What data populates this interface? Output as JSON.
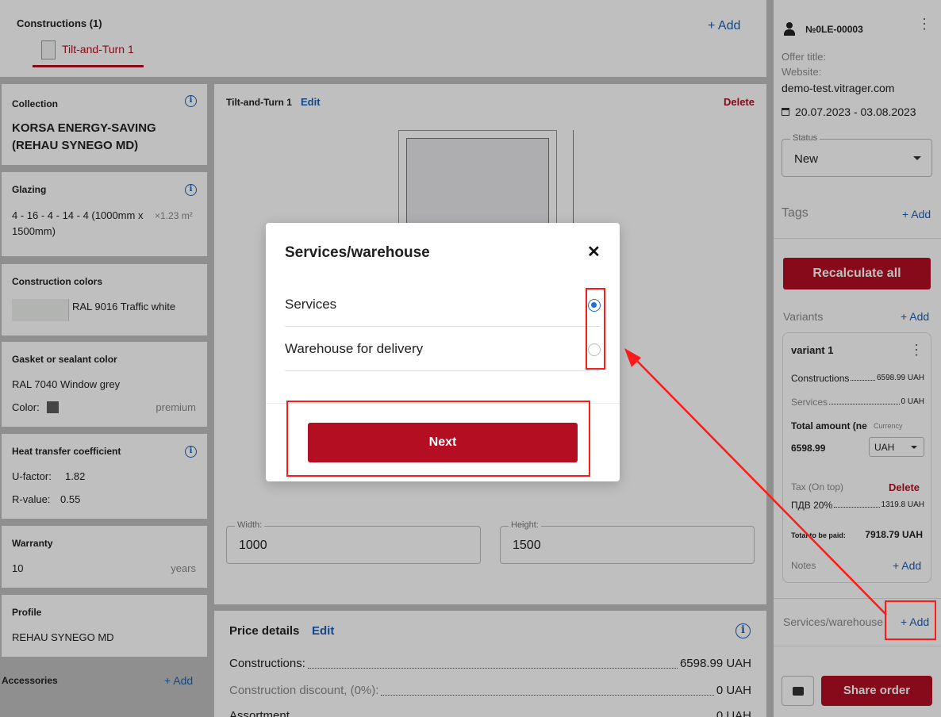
{
  "constructions": {
    "title": "Constructions (1)",
    "add": "+ Add",
    "tab": "Tilt-and-Turn 1"
  },
  "cards": {
    "collection": {
      "title": "Collection",
      "value": "KORSA ENERGY-SAVING (REHAU SYNEGO MD)"
    },
    "glazing": {
      "title": "Glazing",
      "value": "4 - 16 - 4 - 14 - 4 (1000mm x 1500mm)",
      "area": "×1.23 m²"
    },
    "colors": {
      "title": "Construction colors",
      "value": "RAL 9016 Traffic white"
    },
    "gasket": {
      "title": "Gasket or sealant color",
      "value": "RAL 7040 Window grey",
      "color_label": "Color:",
      "premium": "premium"
    },
    "heat": {
      "title": "Heat transfer coefficient",
      "u_label": "U-factor:",
      "u_value": "1.82",
      "r_label": "R-value:",
      "r_value": "0.55"
    },
    "warranty": {
      "title": "Warranty",
      "value": "10",
      "unit": "years"
    },
    "profile": {
      "title": "Profile",
      "value": "REHAU SYNEGO MD"
    },
    "accessories": {
      "title": "Accessories",
      "add": "+ Add"
    }
  },
  "center": {
    "name": "Tilt-and-Turn 1",
    "edit": "Edit",
    "delete": "Delete",
    "width_label": "Width:",
    "width_value": "1000",
    "height_label": "Height:",
    "height_value": "1500"
  },
  "price": {
    "title": "Price details",
    "edit": "Edit",
    "rows": [
      {
        "label": "Constructions:",
        "value": "6598.99 UAH"
      },
      {
        "label": "Construction discount, (0%):",
        "value": "0 UAH"
      },
      {
        "label": "Assortment",
        "value": "0 UAH"
      }
    ]
  },
  "right": {
    "order_id": "№0LE-00003",
    "offer_title": "Offer title:",
    "website": "Website:",
    "domain": "demo-test.vitrager.com",
    "dates": "20.07.2023 - 03.08.2023",
    "status_label": "Status",
    "status_value": "New",
    "tags": "Tags",
    "tags_add": "+ Add",
    "recalc": "Recalculate all",
    "variants": "Variants",
    "variants_add": "+ Add",
    "variant": {
      "name": "variant 1",
      "constructions_label": "Constructions",
      "constructions_value": "6598.99 UAH",
      "services_label": "Services",
      "services_value": "0 UAH",
      "total_label": "Total amount (ne",
      "currency_label": "Currency",
      "total_value": "6598.99",
      "currency": "UAH",
      "tax_label": "Tax (On top)",
      "tax_delete": "Delete",
      "vat_label": "ПДВ 20%",
      "vat_value": "1319.8 UAH",
      "pay_label": "Total to be paid:",
      "pay_value": "7918.79 UAH",
      "notes": "Notes",
      "notes_add": "+ Add"
    },
    "services": "Services/warehouse",
    "services_add": "+ Add",
    "share": "Share order"
  },
  "modal": {
    "title": "Services/warehouse",
    "options": [
      "Services",
      "Warehouse for delivery"
    ],
    "selected": 0,
    "next": "Next"
  },
  "colors": {
    "accent_red": "#b30e22",
    "link_blue": "#1a5fb4",
    "radio_blue": "#1a6fd8",
    "highlight": "#ff1a1a"
  }
}
